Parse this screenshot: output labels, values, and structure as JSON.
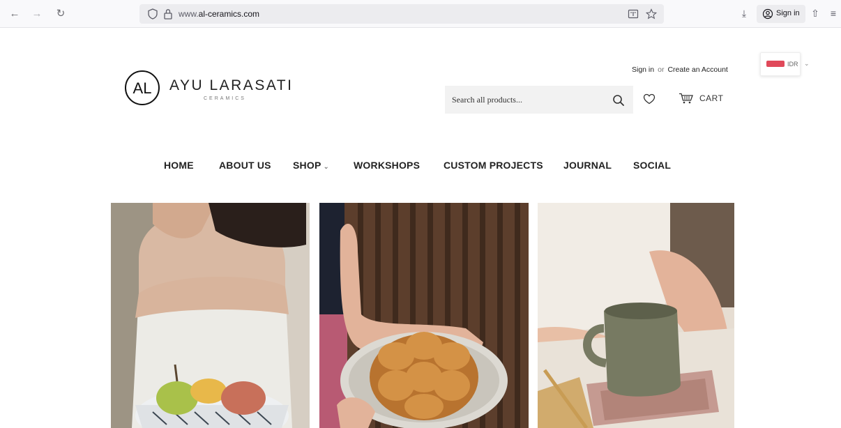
{
  "browser": {
    "url_prefix": "www.",
    "url_domain": "al-ceramics.com",
    "signin_label": "Sign in"
  },
  "site": {
    "logo_mark_text": "AL",
    "brand_name": "AYU LARASATI",
    "brand_sub": "CERAMICS",
    "account": {
      "signin": "Sign in",
      "or": "or",
      "create": "Create an Account"
    },
    "currency": {
      "code": "IDR",
      "flag_color": "#e0495a"
    },
    "search_placeholder": "Search all products...",
    "cart_label": "CART"
  },
  "nav": {
    "items": [
      {
        "label": "HOME"
      },
      {
        "label": "ABOUT US"
      },
      {
        "label": "SHOP"
      },
      {
        "label": "WORKSHOPS"
      },
      {
        "label": "CUSTOM PROJECTS"
      },
      {
        "label": "JOURNAL"
      },
      {
        "label": "SOCIAL"
      }
    ]
  },
  "colors": {
    "accent_text": "#222222",
    "search_bg": "#f2f2f2"
  }
}
